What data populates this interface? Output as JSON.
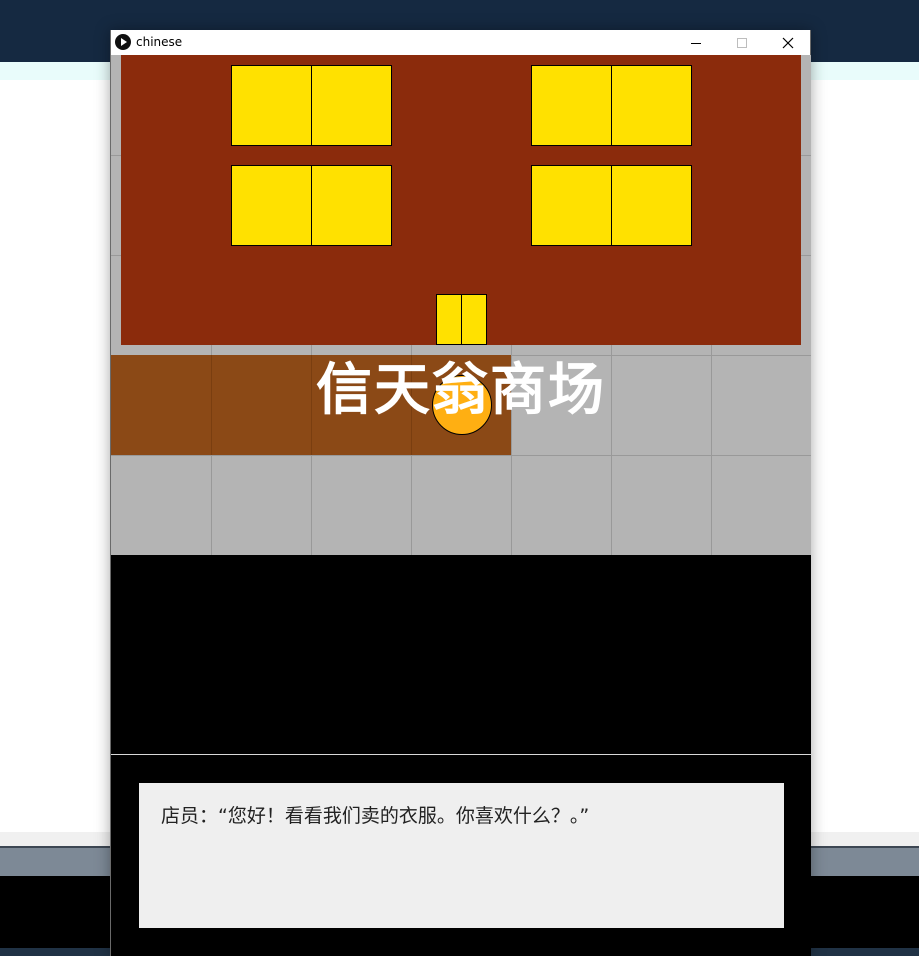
{
  "window": {
    "title": "chinese",
    "controls": {
      "minimize_icon": "minimize-icon",
      "maximize_icon": "maximize-icon",
      "close_icon": "close-icon"
    }
  },
  "scene": {
    "shop_sign": "信天翁商场",
    "colors": {
      "building": "#8b2b0c",
      "windows": "#ffe100",
      "floor": "#8b4916",
      "ground": "#b4b4b4",
      "player": "#ffaf12"
    }
  },
  "dialog": {
    "text": "店员：“您好！看看我们卖的衣服。你喜欢什么？。”"
  }
}
